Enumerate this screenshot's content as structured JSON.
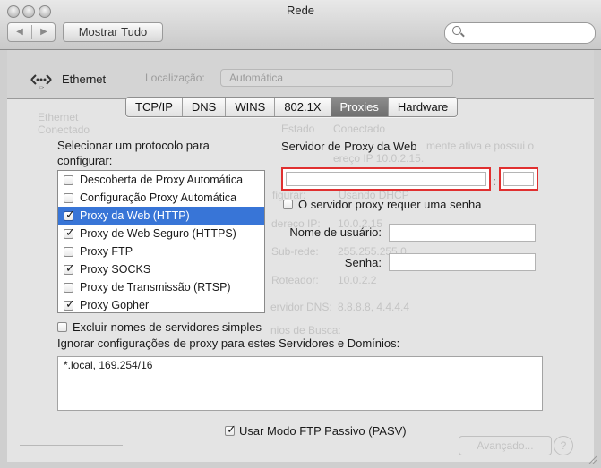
{
  "window": {
    "title": "Rede",
    "title_behind": "Rede",
    "nav_back": "◀",
    "nav_forward": "▶",
    "show_all": "Mostrar Tudo",
    "search_placeholder": ""
  },
  "header": {
    "interface_label": "Ethernet"
  },
  "background": {
    "location_label": "Localização:",
    "location_value": "Automática",
    "sidebar_item": "Ethernet",
    "sidebar_status": "Conectado",
    "status_label": "Estado",
    "status_value": "Conectado",
    "status_desc_line1": "mente ativa e possui o",
    "status_desc_line2": "ereço IP 10.0.2.15.",
    "configure_label": "figurar:",
    "configure_value": "Usando DHCP",
    "ip_label": "dereço IP:",
    "ip_value": "10.0.2.15",
    "subnet_label": "Sub-rede:",
    "subnet_value": "255.255.255.0",
    "router_label": "Roteador:",
    "router_value": "10.0.2.2",
    "dns_label": "ervidor DNS:",
    "dns_value": "8.8.8.8, 4.4.4.4",
    "search_domain_label": "nios de Busca:",
    "advanced": "Avançado...",
    "help": "?"
  },
  "tabs": [
    {
      "label": "TCP/IP",
      "active": false
    },
    {
      "label": "DNS",
      "active": false
    },
    {
      "label": "WINS",
      "active": false
    },
    {
      "label": "802.1X",
      "active": false
    },
    {
      "label": "Proxies",
      "active": true
    },
    {
      "label": "Hardware",
      "active": false
    }
  ],
  "protocols": {
    "label": "Selecionar um protocolo para configurar:",
    "items": [
      {
        "label": "Descoberta de Proxy Automática",
        "checked": false,
        "selected": false
      },
      {
        "label": "Configuração Proxy Automática",
        "checked": false,
        "selected": false
      },
      {
        "label": "Proxy da Web (HTTP)",
        "checked": true,
        "selected": true
      },
      {
        "label": "Proxy de Web Seguro (HTTPS)",
        "checked": true,
        "selected": false
      },
      {
        "label": "Proxy FTP",
        "checked": false,
        "selected": false
      },
      {
        "label": "Proxy SOCKS",
        "checked": true,
        "selected": false
      },
      {
        "label": "Proxy de Transmissão (RTSP)",
        "checked": false,
        "selected": false
      },
      {
        "label": "Proxy Gopher",
        "checked": true,
        "selected": false
      }
    ]
  },
  "server": {
    "title": "Servidor de Proxy da Web",
    "host_value": "",
    "colon": ":",
    "port_value": "",
    "password_required": "O servidor proxy requer uma senha",
    "password_required_checked": false,
    "username_label": "Nome de usuário:",
    "username_value": "",
    "password_label": "Senha:",
    "password_value": ""
  },
  "bypass": {
    "exclude_simple_label": "Excluir nomes de servidores simples",
    "exclude_simple_checked": false,
    "label": "Ignorar configurações de proxy para estes Servidores e Domínios:",
    "value": "*.local, 169.254/16"
  },
  "ftp": {
    "pasv_label": "Usar Modo FTP Passivo (PASV)",
    "pasv_checked": true
  },
  "colors": {
    "selection": "#3875d7",
    "highlight_border": "#e03030",
    "active_tab": "#7a7a7a"
  }
}
